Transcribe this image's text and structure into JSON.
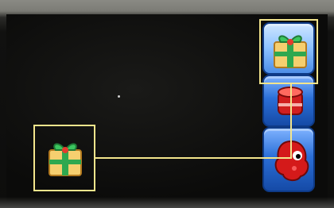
{
  "board": {
    "tiles_column": [
      {
        "piece": "gift-box",
        "state": "selected"
      },
      {
        "piece": "red-drum",
        "state": "normal"
      },
      {
        "piece": "red-creature",
        "state": "normal"
      }
    ],
    "loose_tile": {
      "piece": "gift-box",
      "state": "selected"
    }
  },
  "colors": {
    "hint_line": "#f3e58c",
    "tile_blue": "#2b6fd8",
    "background": "#0b0b0a"
  }
}
